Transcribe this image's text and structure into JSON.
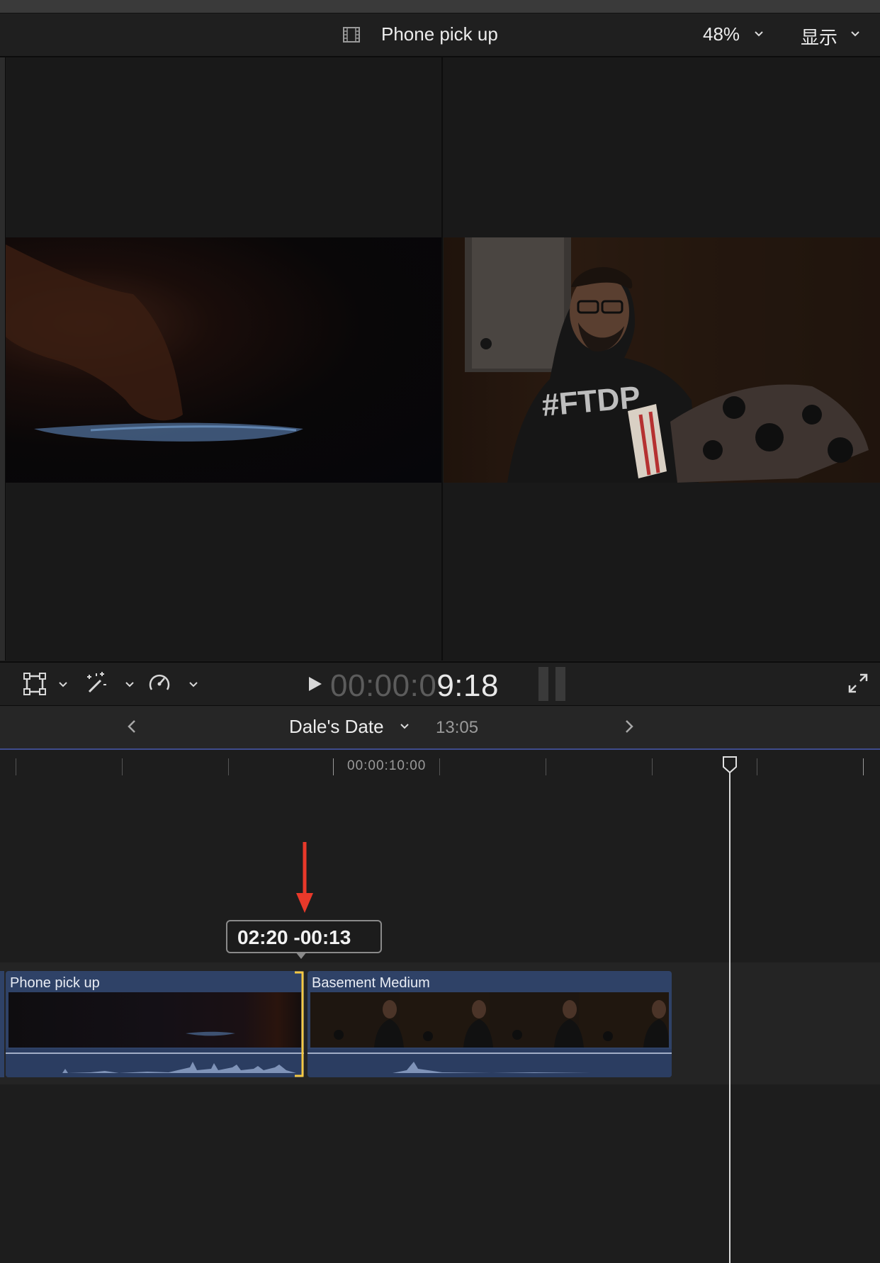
{
  "viewer": {
    "clip_title": "Phone pick up",
    "zoom_label": "48%",
    "display_label": "显示",
    "left_frame_caption": "",
    "right_frame_caption": "#FTDP"
  },
  "transport": {
    "timecode_dim": "00:00:0",
    "timecode_lit": "9:18"
  },
  "timeline": {
    "project_name": "Dale's Date",
    "project_duration": "13:05",
    "ruler_time": "00:00:10:00",
    "tooltip": "02:20  -00:13",
    "clips": [
      {
        "label": "Phone pick up"
      },
      {
        "label": "Basement Medium"
      }
    ]
  },
  "colors": {
    "accent_blue": "#3f4c8c",
    "clip_blue": "#2f4267",
    "edit_yellow": "#f5c842",
    "annotation_red": "#e8392a"
  }
}
